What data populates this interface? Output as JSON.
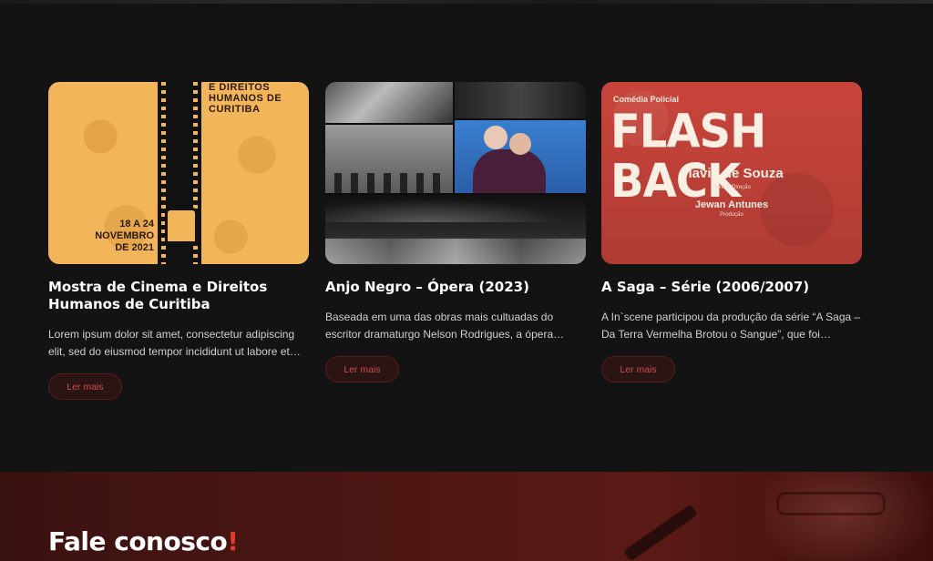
{
  "cards": [
    {
      "title": "Mostra de Cinema e Direitos Humanos de Curitiba",
      "excerpt": "Lorem ipsum dolor sit amet, consectetur adipiscing elit, sed do eiusmod tempor incididunt ut labore et…",
      "button_label": "Ler mais",
      "thumb": {
        "top_text": "E DIREITOS HUMANOS DE CURITIBA",
        "date_text": "18 A 24 NOVEMBRO DE 2021"
      }
    },
    {
      "title": "Anjo Negro – Ópera (2023)",
      "excerpt": "Baseada em uma das obras mais cultuadas do escritor dramaturgo Nelson Rodrigues, a ópera “Anj…",
      "button_label": "Ler mais"
    },
    {
      "title": "A Saga – Série (2006/2007)",
      "excerpt": "A In`scene participou da produção da série “A Saga – Da Terra Vermelha Brotou o Sangue”, que foi exibida…",
      "button_label": "Ler mais",
      "thumb": {
        "genre": "Comédia Policial",
        "title": "FLASH BACK",
        "author": "Flavio de Souza",
        "author_role": "Texto e Direção",
        "producer": "Jewan Antunes",
        "producer_role": "Produção"
      }
    }
  ],
  "contact": {
    "title": "Fale conosco",
    "accent": "!"
  },
  "colors": {
    "background": "#131313",
    "accent": "#e23b2e",
    "button_border": "#5a1c1c",
    "button_text": "#d24a4a"
  }
}
